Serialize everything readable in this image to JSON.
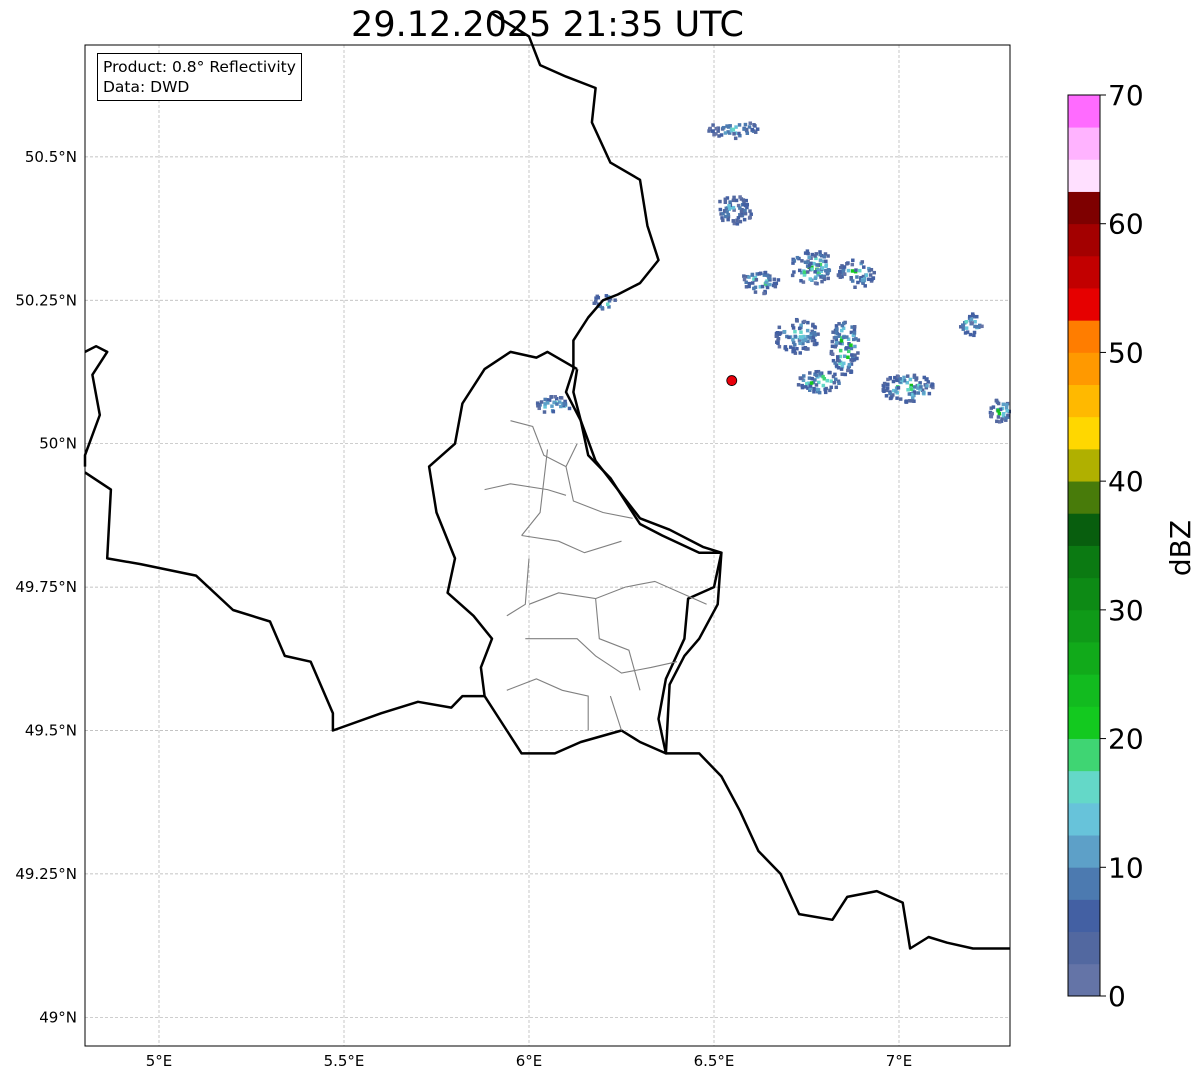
{
  "title": "29.12.2025 21:35 UTC",
  "info": {
    "product": "Product: 0.8° Reflectivity",
    "data": "Data: DWD"
  },
  "map": {
    "lon_range": [
      4.8,
      7.3
    ],
    "lat_range": [
      48.95,
      50.695
    ],
    "grid": true,
    "lon_ticks": [
      {
        "value": 5.0,
        "label": "5°E"
      },
      {
        "value": 5.5,
        "label": "5.5°E"
      },
      {
        "value": 6.0,
        "label": "6°E"
      },
      {
        "value": 6.5,
        "label": "6.5°E"
      },
      {
        "value": 7.0,
        "label": "7°E"
      }
    ],
    "lat_ticks": [
      {
        "value": 49.0,
        "label": "49°N"
      },
      {
        "value": 49.25,
        "label": "49.25°N"
      },
      {
        "value": 49.5,
        "label": "49.5°N"
      },
      {
        "value": 49.75,
        "label": "49.75°N"
      },
      {
        "value": 50.0,
        "label": "50°N"
      },
      {
        "value": 50.25,
        "label": "50.25°N"
      },
      {
        "value": 50.5,
        "label": "50.5°N"
      }
    ],
    "radar_site": {
      "lon": 6.548,
      "lat": 50.11,
      "color": "#e8000b"
    },
    "echo_cells": [
      {
        "lon": 6.62,
        "lat": 50.285,
        "w": 0.1,
        "h": 0.045,
        "level": 8
      },
      {
        "lon": 6.76,
        "lat": 50.31,
        "w": 0.12,
        "h": 0.06,
        "level": 12
      },
      {
        "lon": 6.88,
        "lat": 50.3,
        "w": 0.1,
        "h": 0.05,
        "level": 10
      },
      {
        "lon": 6.72,
        "lat": 50.19,
        "w": 0.12,
        "h": 0.06,
        "level": 8
      },
      {
        "lon": 6.85,
        "lat": 50.17,
        "w": 0.08,
        "h": 0.1,
        "level": 12
      },
      {
        "lon": 6.78,
        "lat": 50.11,
        "w": 0.12,
        "h": 0.04,
        "level": 10
      },
      {
        "lon": 7.02,
        "lat": 50.1,
        "w": 0.14,
        "h": 0.05,
        "level": 12
      },
      {
        "lon": 7.19,
        "lat": 50.21,
        "w": 0.06,
        "h": 0.04,
        "level": 10
      },
      {
        "lon": 7.27,
        "lat": 50.06,
        "w": 0.06,
        "h": 0.04,
        "level": 12
      },
      {
        "lon": 6.06,
        "lat": 50.07,
        "w": 0.1,
        "h": 0.03,
        "level": 8
      },
      {
        "lon": 6.2,
        "lat": 50.25,
        "w": 0.06,
        "h": 0.03,
        "level": 8
      },
      {
        "lon": 6.55,
        "lat": 50.41,
        "w": 0.1,
        "h": 0.05,
        "level": 6
      },
      {
        "lon": 6.55,
        "lat": 50.55,
        "w": 0.14,
        "h": 0.03,
        "level": 6
      }
    ],
    "borders": {
      "luxembourg_outer": [
        [
          6.13,
          50.13
        ],
        [
          6.05,
          50.16
        ],
        [
          6.02,
          50.15
        ],
        [
          5.95,
          50.16
        ],
        [
          5.88,
          50.13
        ],
        [
          5.82,
          50.07
        ],
        [
          5.8,
          50.0
        ],
        [
          5.73,
          49.96
        ],
        [
          5.75,
          49.88
        ],
        [
          5.8,
          49.8
        ],
        [
          5.78,
          49.74
        ],
        [
          5.85,
          49.7
        ],
        [
          5.9,
          49.66
        ],
        [
          5.87,
          49.61
        ],
        [
          5.88,
          49.56
        ],
        [
          5.92,
          49.52
        ],
        [
          5.98,
          49.46
        ],
        [
          6.07,
          49.46
        ],
        [
          6.14,
          49.48
        ],
        [
          6.25,
          49.5
        ],
        [
          6.3,
          49.48
        ],
        [
          6.37,
          49.46
        ],
        [
          6.35,
          49.52
        ],
        [
          6.37,
          49.59
        ],
        [
          6.42,
          49.66
        ],
        [
          6.43,
          49.73
        ],
        [
          6.5,
          49.75
        ],
        [
          6.52,
          49.81
        ],
        [
          6.47,
          49.82
        ],
        [
          6.38,
          49.85
        ],
        [
          6.3,
          49.87
        ],
        [
          6.24,
          49.92
        ],
        [
          6.18,
          49.97
        ],
        [
          6.14,
          50.04
        ],
        [
          6.12,
          50.09
        ],
        [
          6.13,
          50.13
        ]
      ],
      "germany_west": [
        [
          5.9,
          50.75
        ],
        [
          6.0,
          50.71
        ],
        [
          6.03,
          50.66
        ],
        [
          6.1,
          50.64
        ],
        [
          6.18,
          50.62
        ],
        [
          6.17,
          50.56
        ],
        [
          6.22,
          50.49
        ],
        [
          6.3,
          50.46
        ],
        [
          6.32,
          50.38
        ],
        [
          6.35,
          50.32
        ],
        [
          6.3,
          50.28
        ],
        [
          6.24,
          50.26
        ],
        [
          6.2,
          50.25
        ],
        [
          6.16,
          50.22
        ],
        [
          6.12,
          50.18
        ],
        [
          6.12,
          50.13
        ],
        [
          6.1,
          50.09
        ],
        [
          6.14,
          50.04
        ],
        [
          6.16,
          49.98
        ],
        [
          6.22,
          49.94
        ],
        [
          6.27,
          49.89
        ],
        [
          6.3,
          49.86
        ],
        [
          6.36,
          49.84
        ],
        [
          6.46,
          49.81
        ],
        [
          6.52,
          49.81
        ],
        [
          6.51,
          49.72
        ],
        [
          6.46,
          49.66
        ],
        [
          6.42,
          49.63
        ],
        [
          6.38,
          49.58
        ],
        [
          6.37,
          49.46
        ],
        [
          6.46,
          49.46
        ],
        [
          6.52,
          49.42
        ],
        [
          6.57,
          49.36
        ],
        [
          6.62,
          49.29
        ],
        [
          6.68,
          49.25
        ],
        [
          6.73,
          49.18
        ],
        [
          6.82,
          49.17
        ],
        [
          6.86,
          49.21
        ],
        [
          6.94,
          49.22
        ],
        [
          7.01,
          49.2
        ],
        [
          7.03,
          49.12
        ],
        [
          7.08,
          49.14
        ],
        [
          7.13,
          49.13
        ],
        [
          7.2,
          49.12
        ],
        [
          7.3,
          49.12
        ]
      ],
      "france_belgium": [
        [
          4.8,
          49.95
        ],
        [
          4.87,
          49.92
        ],
        [
          4.86,
          49.8
        ],
        [
          4.95,
          49.79
        ],
        [
          5.1,
          49.77
        ],
        [
          5.2,
          49.71
        ],
        [
          5.3,
          49.69
        ],
        [
          5.34,
          49.63
        ],
        [
          5.41,
          49.62
        ],
        [
          5.47,
          49.53
        ],
        [
          5.47,
          49.5
        ],
        [
          5.6,
          49.53
        ],
        [
          5.7,
          49.55
        ],
        [
          5.79,
          49.54
        ],
        [
          5.82,
          49.56
        ],
        [
          5.88,
          49.56
        ]
      ],
      "belgium_north": [
        [
          4.8,
          50.16
        ],
        [
          4.83,
          50.17
        ],
        [
          4.86,
          50.16
        ],
        [
          4.82,
          50.12
        ],
        [
          4.84,
          50.05
        ],
        [
          4.8,
          49.98
        ],
        [
          4.8,
          49.96
        ]
      ],
      "lux_cantons": [
        [
          [
            5.88,
            49.92
          ],
          [
            5.95,
            49.93
          ],
          [
            6.05,
            49.92
          ],
          [
            6.1,
            49.91
          ]
        ],
        [
          [
            5.95,
            50.04
          ],
          [
            6.01,
            50.03
          ],
          [
            6.04,
            49.98
          ],
          [
            6.1,
            49.96
          ],
          [
            6.13,
            50.0
          ]
        ],
        [
          [
            6.05,
            49.99
          ],
          [
            6.03,
            49.88
          ],
          [
            5.98,
            49.84
          ]
        ],
        [
          [
            6.1,
            49.96
          ],
          [
            6.12,
            49.9
          ],
          [
            6.2,
            49.88
          ],
          [
            6.28,
            49.87
          ]
        ],
        [
          [
            5.98,
            49.84
          ],
          [
            6.08,
            49.83
          ],
          [
            6.15,
            49.81
          ],
          [
            6.25,
            49.83
          ]
        ],
        [
          [
            6.0,
            49.8
          ],
          [
            5.99,
            49.72
          ],
          [
            5.94,
            49.7
          ]
        ],
        [
          [
            6.0,
            49.72
          ],
          [
            6.08,
            49.74
          ],
          [
            6.18,
            49.73
          ],
          [
            6.26,
            49.75
          ],
          [
            6.34,
            49.76
          ],
          [
            6.48,
            49.72
          ]
        ],
        [
          [
            6.18,
            49.73
          ],
          [
            6.19,
            49.66
          ],
          [
            6.27,
            49.64
          ],
          [
            6.3,
            49.57
          ]
        ],
        [
          [
            5.99,
            49.66
          ],
          [
            6.05,
            49.66
          ],
          [
            6.13,
            49.66
          ],
          [
            6.18,
            49.63
          ],
          [
            6.25,
            49.6
          ],
          [
            6.33,
            49.61
          ],
          [
            6.4,
            49.62
          ]
        ],
        [
          [
            5.94,
            49.57
          ],
          [
            6.02,
            49.59
          ],
          [
            6.09,
            49.57
          ],
          [
            6.16,
            49.56
          ],
          [
            6.16,
            49.5
          ]
        ],
        [
          [
            6.25,
            49.5
          ],
          [
            6.22,
            49.56
          ]
        ]
      ]
    }
  },
  "colorbar": {
    "label": "dBZ",
    "min": 0,
    "max": 70,
    "step": 2.5,
    "ticks": [
      {
        "value": 0,
        "label": "0"
      },
      {
        "value": 10,
        "label": "10"
      },
      {
        "value": 20,
        "label": "20"
      },
      {
        "value": 30,
        "label": "30"
      },
      {
        "value": 40,
        "label": "40"
      },
      {
        "value": 50,
        "label": "50"
      },
      {
        "value": 60,
        "label": "60"
      },
      {
        "value": 70,
        "label": "70"
      }
    ],
    "colors": [
      "#6474a7",
      "#5268a0",
      "#4360a3",
      "#4c7ab0",
      "#5da0c8",
      "#67c3da",
      "#64d8c8",
      "#3fd573",
      "#13c91f",
      "#12bb1f",
      "#11aa1a",
      "#0f9a18",
      "#0d8a15",
      "#0b7a12",
      "#085e0e",
      "#487b0a",
      "#b0b000",
      "#ffd700",
      "#ffb900",
      "#ff9900",
      "#ff7d00",
      "#e60000",
      "#c20000",
      "#a30000",
      "#7e0000",
      "#ffe0ff",
      "#ffb3ff",
      "#ff6bff",
      "#ef34ef"
    ]
  }
}
